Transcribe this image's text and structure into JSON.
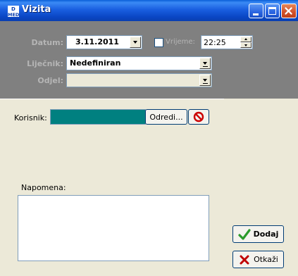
{
  "window": {
    "title": "Vizita",
    "app_icon_letters": "MED"
  },
  "form": {
    "datum_label": "Datum:",
    "datum_value": "3.11.2011",
    "vrijeme_label": "Vrijeme:",
    "vrijeme_value": "22:25",
    "vrijeme_checked": false,
    "lijecnik_label": "Liječnik:",
    "lijecnik_value": "Nedefiniran",
    "odjel_label": "Odjel:",
    "odjel_value": ""
  },
  "korisnik": {
    "label": "Korisnik:",
    "value": "",
    "odredi_label": "Odredi..."
  },
  "napomena": {
    "label": "Napomena:",
    "value": ""
  },
  "actions": {
    "dodaj_label": "Dodaj",
    "otkazi_label": "Otkaži"
  },
  "colors": {
    "title_bar": "#1a5fe0",
    "top_panel": "#808080",
    "korisnik_field": "#008080",
    "dialog_bg": "#ece9d8",
    "no_icon": "#cc0000",
    "check_icon": "#2a9a2a",
    "cancel_icon": "#c00000"
  },
  "icons": {
    "app": "med-app-icon",
    "minimize": "minimize-icon",
    "maximize": "maximize-icon",
    "close": "close-icon",
    "clear": "no-entry-icon",
    "add": "checkmark-icon",
    "cancel": "x-icon"
  }
}
